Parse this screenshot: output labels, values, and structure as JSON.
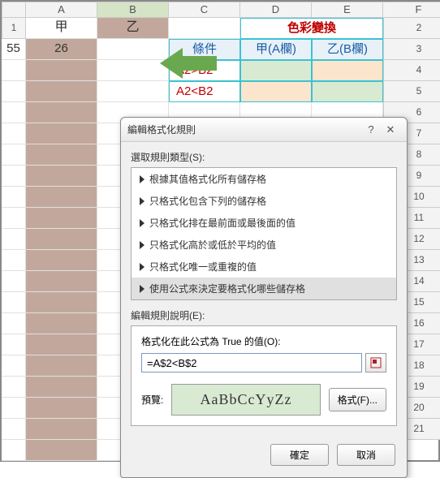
{
  "columns": [
    "",
    "A",
    "B",
    "C",
    "D",
    "E",
    "F"
  ],
  "headers": {
    "jia": "甲",
    "yi": "乙"
  },
  "values": {
    "a2": "55",
    "b2": "26"
  },
  "table": {
    "title": "色彩變換",
    "cond": "條件",
    "colA": "甲(A欄)",
    "colB": "乙(B欄)",
    "r1": "A2>B2",
    "r2": "A2<B2"
  },
  "dialog": {
    "title": "編輯格式化規則",
    "sect1": "選取規則類型(S):",
    "rules": [
      "根據其值格式化所有儲存格",
      "只格式化包含下列的儲存格",
      "只格式化排在最前面或最後面的值",
      "只格式化高於或低於平均的值",
      "只格式化唯一或重複的值",
      "使用公式來決定要格式化哪些儲存格"
    ],
    "sect2": "編輯規則說明(E):",
    "formula_label": "格式化在此公式為 True 的值(O):",
    "formula": "=A$2<B$2",
    "preview_label": "預覽:",
    "preview_text": "AaBbCcYyZz",
    "format_btn": "格式(F)...",
    "ok": "確定",
    "cancel": "取消"
  }
}
